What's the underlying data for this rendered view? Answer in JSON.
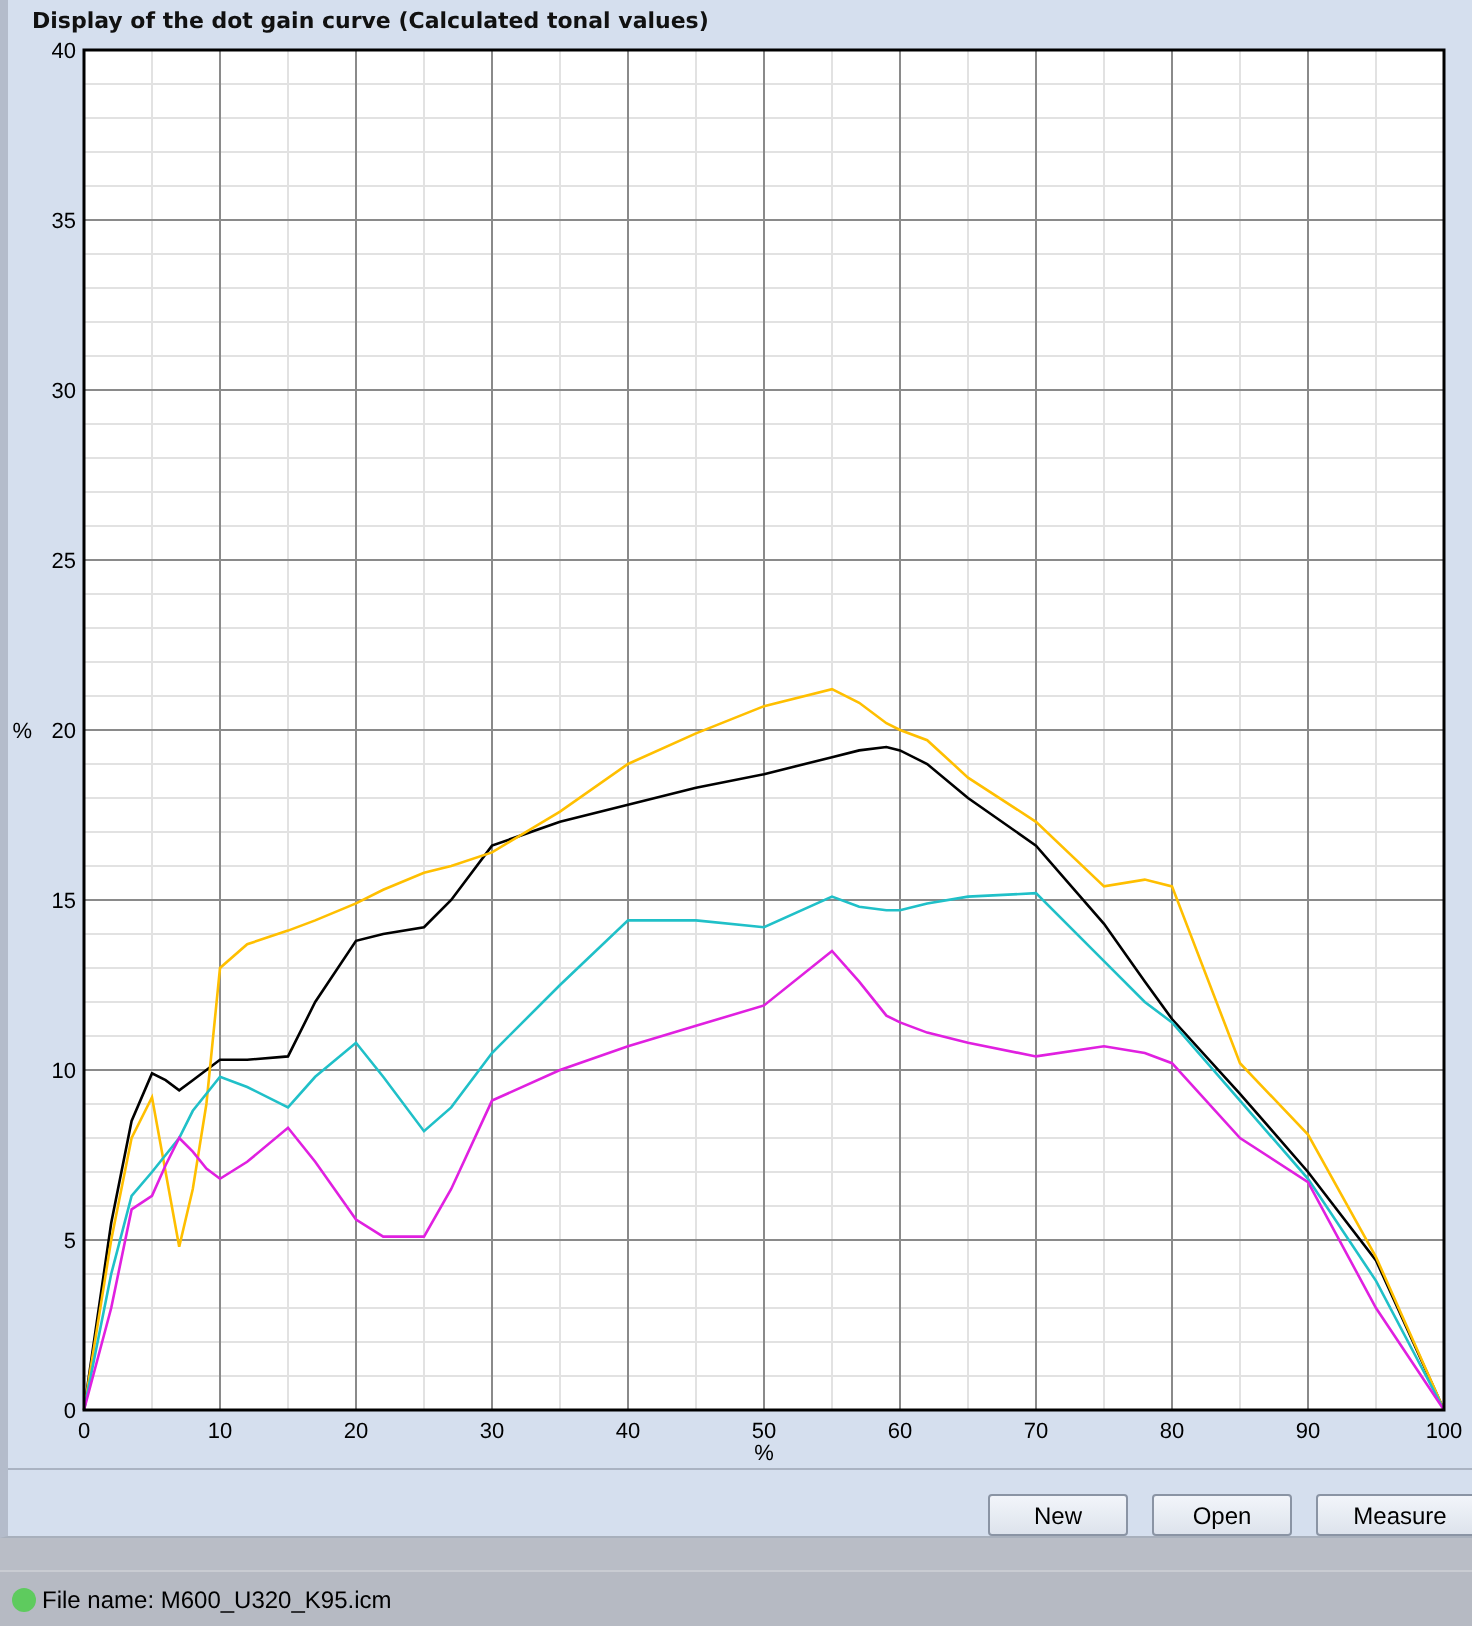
{
  "title": "Display of the dot gain curve (Calculated tonal values)",
  "chart": {
    "chart_data": {
      "type": "line",
      "grid": true,
      "xlabel": "%",
      "ylabel": "%",
      "xlim": [
        0,
        100
      ],
      "ylim": [
        0,
        40
      ],
      "xticks": [
        0,
        10,
        20,
        30,
        40,
        50,
        60,
        70,
        80,
        90,
        100
      ],
      "yticks": [
        0,
        5,
        10,
        15,
        20,
        25,
        30,
        35,
        40
      ],
      "x": [
        0,
        2,
        3.5,
        5,
        6,
        7,
        8,
        9,
        10,
        12,
        15,
        17,
        20,
        22,
        25,
        27,
        30,
        35,
        40,
        45,
        50,
        55,
        57,
        59,
        60,
        62,
        65,
        70,
        75,
        78,
        80,
        85,
        90,
        95,
        100
      ],
      "series": [
        {
          "color": "#000000",
          "values": [
            0,
            5.5,
            8.5,
            9.9,
            9.7,
            9.4,
            9.7,
            10,
            10.3,
            10.3,
            10.4,
            12,
            13.8,
            14,
            14.2,
            15,
            16.6,
            17.3,
            17.8,
            18.3,
            18.7,
            19.2,
            19.4,
            19.5,
            19.4,
            19,
            18,
            16.6,
            14.3,
            12.6,
            11.5,
            9.3,
            7,
            4.4,
            0
          ]
        },
        {
          "color": "#ffbf00",
          "values": [
            0,
            5,
            8,
            9.2,
            7,
            4.8,
            6.5,
            9,
            13,
            13.7,
            14.1,
            14.4,
            14.9,
            15.3,
            15.8,
            16,
            16.4,
            17.6,
            19,
            19.9,
            20.7,
            21.2,
            20.8,
            20.2,
            20,
            19.7,
            18.6,
            17.3,
            15.4,
            15.6,
            15.4,
            10.2,
            8.1,
            4.5,
            0
          ]
        },
        {
          "color": "#20c0c8",
          "values": [
            0,
            4,
            6.3,
            7,
            7.5,
            8,
            8.8,
            9.3,
            9.8,
            9.5,
            8.9,
            9.8,
            10.8,
            9.8,
            8.2,
            8.9,
            10.5,
            12.5,
            14.4,
            14.4,
            14.2,
            15.1,
            14.8,
            14.7,
            14.7,
            14.9,
            15.1,
            15.2,
            13.2,
            12,
            11.4,
            9.1,
            6.8,
            3.8,
            0
          ]
        },
        {
          "color": "#e020e0",
          "values": [
            0,
            3,
            5.9,
            6.3,
            7.2,
            8,
            7.6,
            7.1,
            6.8,
            7.3,
            8.3,
            7.3,
            5.6,
            5.1,
            5.1,
            6.5,
            9.1,
            10,
            10.7,
            11.3,
            11.9,
            13.5,
            12.6,
            11.6,
            11.4,
            11.1,
            10.8,
            10.4,
            10.7,
            10.5,
            10.2,
            8,
            6.7,
            3,
            0
          ]
        }
      ]
    }
  },
  "buttons": [
    "New",
    "Open",
    "Measure"
  ],
  "status_bar": {
    "text": "File name: M600_U320_K95.icm",
    "color": "#5ecb5e"
  }
}
